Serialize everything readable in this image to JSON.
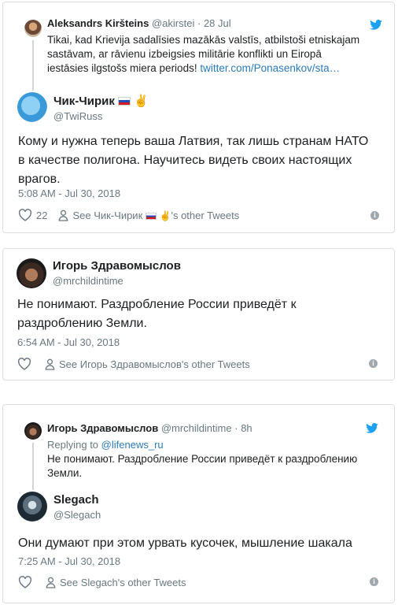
{
  "tweet1": {
    "quoted": {
      "author_name": "Aleksandrs Kiršteins",
      "handle": "@akirstei",
      "sep": "·",
      "time": "28 Jul",
      "text_line1": "Tikai, kad Krievija sadalīsies mazākās valstīs, atbilstoši etniskajam",
      "text_line2": "sastāvam, ar rāvienu izbeigsies militārie konflikti un Eiropā",
      "text_line3_prefix": "iestāsies ilgstošs miera periods!",
      "text_line3_link": "twitter.com/Ponasenkov/sta…"
    },
    "author_name": "Чик-Чирик",
    "handle": "@TwiRuss",
    "text_line1": "Кому и нужна теперь ваша Латвия, так лишь странам НАТО",
    "text_line2": "в качестве полигона. Научитесь видеть своих настоящих",
    "text_line3": "врагов.",
    "timestamp": "5:08 AM - Jul 30, 2018",
    "likes": "22",
    "see_other_prefix": "See Чик-Чирик",
    "see_other_suffix": "'s other Tweets"
  },
  "tweet2": {
    "author_name": "Игорь Здравомыслов",
    "handle": "@mrchildintime",
    "text_line1": "Не понимают. Раздробление России приведёт к",
    "text_line2": "раздроблению Земли.",
    "timestamp": "6:54 AM - Jul 30, 2018",
    "see_other": "See Игорь Здравомыслов's other Tweets"
  },
  "tweet3": {
    "quoted": {
      "author_name": "Игорь Здравомыслов",
      "handle": "@mrchildintime",
      "sep": "·",
      "time": "8h",
      "replying_prefix": "Replying to",
      "replying_handle": "@lifenews_ru",
      "text_line1": "Не понимают. Раздробление России приведёт к раздроблению",
      "text_line2": "Земли."
    },
    "author_name": "Slegach",
    "handle": "@Slegach",
    "text_line1": "Они думают при этом урвать кусочек, мышление шакала",
    "timestamp": "7:25 AM - Jul 30, 2018",
    "see_other": "See Slegach's other Tweets"
  },
  "icons": {
    "twitter_color": "#1da1f2",
    "heart": "heart-icon",
    "person": "person-icon",
    "info": "info-icon",
    "bird": "twitter-bird-icon"
  }
}
